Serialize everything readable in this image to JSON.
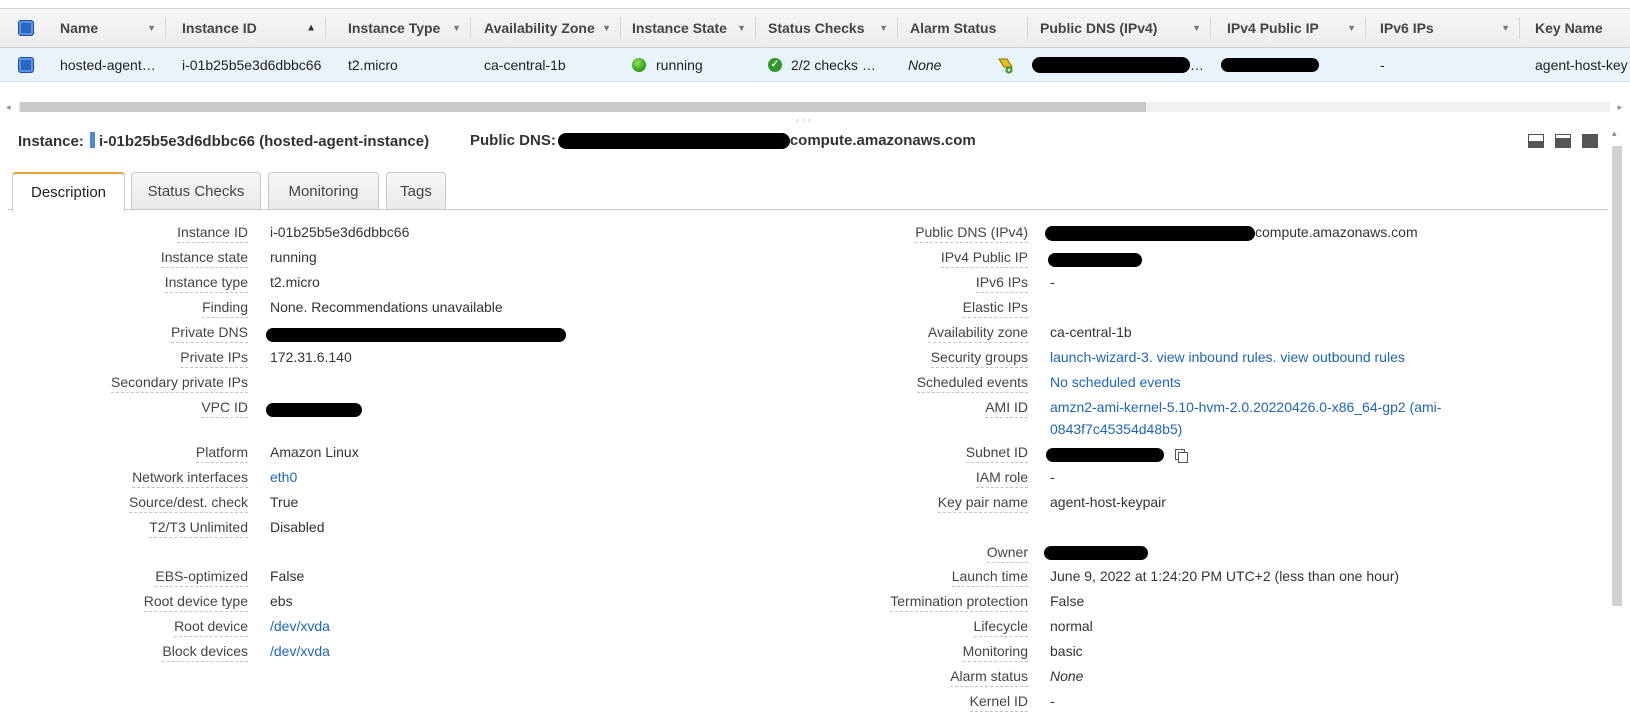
{
  "table": {
    "columns": [
      {
        "label": "Name"
      },
      {
        "label": "Instance ID"
      },
      {
        "label": "Instance Type"
      },
      {
        "label": "Availability Zone"
      },
      {
        "label": "Instance State"
      },
      {
        "label": "Status Checks"
      },
      {
        "label": "Alarm Status"
      },
      {
        "label": "Public DNS (IPv4)"
      },
      {
        "label": "IPv4 Public IP"
      },
      {
        "label": "IPv6 IPs"
      },
      {
        "label": "Key Name"
      }
    ],
    "row": {
      "name": "hosted-agent…",
      "instance_id": "i-01b25b5e3d6dbbc66",
      "instance_type": "t2.micro",
      "availability_zone": "ca-central-1b",
      "instance_state": "running",
      "status_checks": "2/2 checks …",
      "alarm_status": "None",
      "public_dns_suffix": "…",
      "ipv6_ips": "-",
      "key_name": "agent-host-key"
    }
  },
  "detail": {
    "instance_label": "Instance:",
    "instance_value": "i-01b25b5e3d6dbbc66 (hosted-agent-instance)",
    "public_dns_label": "Public DNS:",
    "public_dns_value": "compute.amazonaws.com",
    "tabs": [
      "Description",
      "Status Checks",
      "Monitoring",
      "Tags"
    ],
    "active_tab": "Description",
    "left_fields": [
      {
        "label": "Instance ID",
        "value": "i-01b25b5e3d6dbbc66"
      },
      {
        "label": "Instance state",
        "value": "running"
      },
      {
        "label": "Instance type",
        "value": "t2.micro"
      },
      {
        "label": "Finding",
        "value": "None. Recommendations unavailable"
      },
      {
        "label": "Private DNS",
        "value": ""
      },
      {
        "label": "Private IPs",
        "value": "172.31.6.140"
      },
      {
        "label": "Secondary private IPs",
        "value": ""
      },
      {
        "label": "VPC ID",
        "value": ""
      },
      {
        "label": "Platform",
        "value": "Amazon Linux"
      },
      {
        "label": "Network interfaces",
        "value": "eth0"
      },
      {
        "label": "Source/dest. check",
        "value": "True"
      },
      {
        "label": "T2/T3 Unlimited",
        "value": "Disabled"
      },
      {
        "label": "EBS-optimized",
        "value": "False"
      },
      {
        "label": "Root device type",
        "value": "ebs"
      },
      {
        "label": "Root device",
        "value": "/dev/xvda"
      },
      {
        "label": "Block devices",
        "value": "/dev/xvda"
      }
    ],
    "right_fields": [
      {
        "label": "Public DNS (IPv4)",
        "value": "compute.amazonaws.com"
      },
      {
        "label": "IPv4 Public IP",
        "value": ""
      },
      {
        "label": "IPv6 IPs",
        "value": "-"
      },
      {
        "label": "Elastic IPs",
        "value": ""
      },
      {
        "label": "Availability zone",
        "value": "ca-central-1b"
      },
      {
        "label": "Security groups",
        "value": "launch-wizard-3. view inbound rules. view outbound rules"
      },
      {
        "label": "Scheduled events",
        "value": "No scheduled events"
      },
      {
        "label": "AMI ID",
        "value": "amzn2-ami-kernel-5.10-hvm-2.0.20220426.0-x86_64-gp2 (ami-",
        "value2": "0843f7c45354d48b5)"
      },
      {
        "label": "Subnet ID",
        "value": ""
      },
      {
        "label": "IAM role",
        "value": "-"
      },
      {
        "label": "Key pair name",
        "value": "agent-host-keypair"
      },
      {
        "label": "Owner",
        "value": ""
      },
      {
        "label": "Launch time",
        "value": "June 9, 2022 at 1:24:20 PM UTC+2 (less than one hour)"
      },
      {
        "label": "Termination protection",
        "value": "False"
      },
      {
        "label": "Lifecycle",
        "value": "normal"
      },
      {
        "label": "Monitoring",
        "value": "basic"
      },
      {
        "label": "Alarm status",
        "value": "None"
      },
      {
        "label": "Kernel ID",
        "value": "-"
      }
    ]
  },
  "colors": {
    "link": "#1f65b8",
    "selected_row": "#e8f3fc",
    "tab_accent": "#e8a33d",
    "checkbox": "#2a67c4"
  }
}
